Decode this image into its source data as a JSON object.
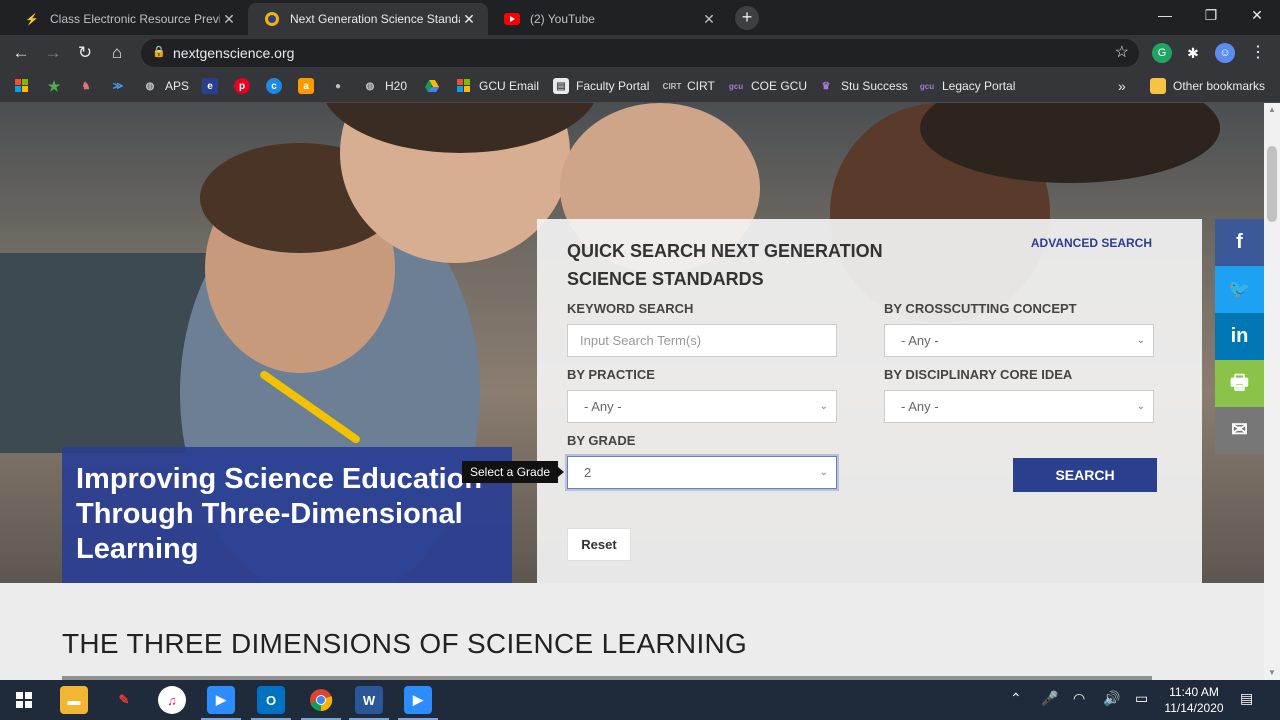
{
  "browser": {
    "tabs": [
      {
        "title": "Class Electronic Resource Preview",
        "icon": "lightning-icon",
        "color": "#2f80ed"
      },
      {
        "title": "Next Generation Science Standards",
        "icon": "nextgen-icon",
        "color": "#f4b400"
      },
      {
        "title": "(2) YouTube",
        "icon": "youtube-icon",
        "color": "#ff0000"
      }
    ],
    "url": "nextgenscience.org",
    "bookmarks": [
      {
        "label": "",
        "icon": "windows-icon"
      },
      {
        "label": "",
        "icon": "star-icon"
      },
      {
        "label": "",
        "icon": "lion-icon"
      },
      {
        "label": "",
        "icon": "fish-icon"
      },
      {
        "label": "APS",
        "icon": "globe-icon"
      },
      {
        "label": "",
        "icon": "edge-icon"
      },
      {
        "label": "",
        "icon": "pinterest-icon"
      },
      {
        "label": "",
        "icon": "c-icon"
      },
      {
        "label": "",
        "icon": "amazon-icon"
      },
      {
        "label": "",
        "icon": "apple-icon"
      },
      {
        "label": "H20",
        "icon": "globe-icon"
      },
      {
        "label": "",
        "icon": "drive-icon"
      },
      {
        "label": "GCU Email",
        "icon": "windows-icon"
      },
      {
        "label": "Faculty Portal",
        "icon": "doc-icon"
      },
      {
        "label": "CIRT",
        "icon": "cirt-icon"
      },
      {
        "label": "COE GCU",
        "icon": "gcu-icon"
      },
      {
        "label": "Stu Success",
        "icon": "trophy-icon"
      },
      {
        "label": "Legacy Portal",
        "icon": "gcu-icon"
      }
    ],
    "bookmarks_overflow": "»",
    "other_bookmarks": "Other bookmarks"
  },
  "hero": {
    "headline": "Improving Science Education Through Three-Dimensional Learning"
  },
  "quick_search": {
    "title": "QUICK SEARCH NEXT GENERATION SCIENCE STANDARDS",
    "advanced_link": "ADVANCED SEARCH",
    "keyword_label": "KEYWORD SEARCH",
    "keyword_placeholder": "Input Search Term(s)",
    "crosscutting_label": "BY CROSSCUTTING CONCEPT",
    "crosscutting_value": "- Any -",
    "practice_label": "BY PRACTICE",
    "practice_value": "- Any -",
    "core_idea_label": "BY DISCIPLINARY CORE IDEA",
    "core_idea_value": "- Any -",
    "grade_label": "BY GRADE",
    "grade_value": "2",
    "grade_tooltip": "Select a Grade",
    "search_button": "SEARCH",
    "reset_button": "Reset"
  },
  "social": [
    {
      "icon": "facebook-icon",
      "glyph": "f",
      "color": "#3b5998"
    },
    {
      "icon": "twitter-icon",
      "glyph": "🐦",
      "color": "#1da1f2"
    },
    {
      "icon": "linkedin-icon",
      "glyph": "in",
      "color": "#0077b5"
    },
    {
      "icon": "print-icon",
      "glyph": "🖶",
      "color": "#8bc34a"
    },
    {
      "icon": "email-icon",
      "glyph": "✉",
      "color": "#777777"
    }
  ],
  "section_heading": "THE THREE DIMENSIONS OF SCIENCE LEARNING",
  "taskbar": {
    "clock_time": "11:40 AM",
    "clock_date": "11/14/2020"
  }
}
